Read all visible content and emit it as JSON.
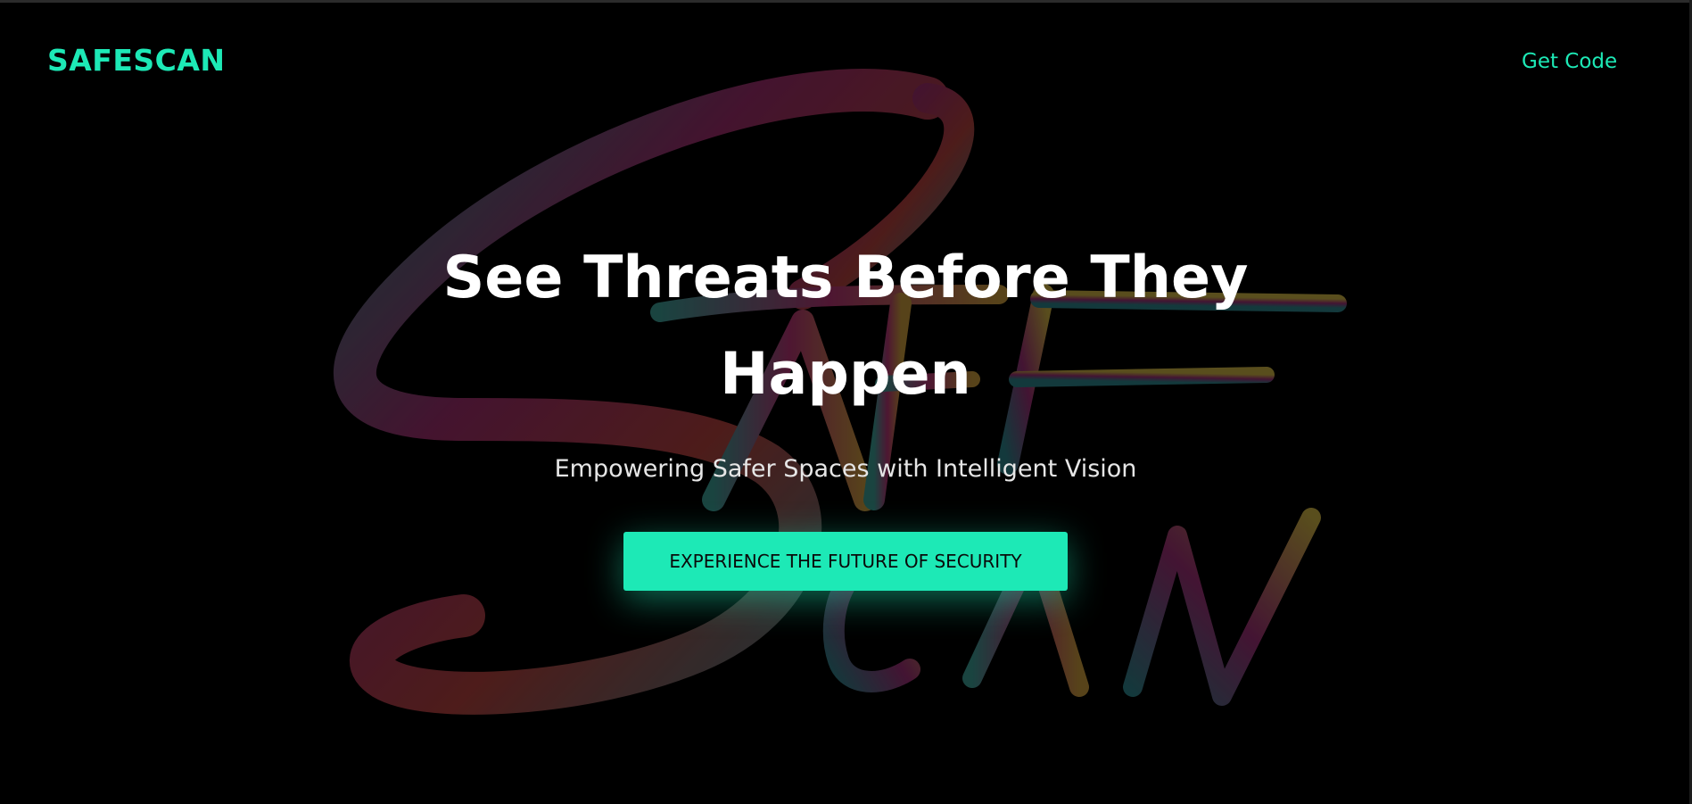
{
  "navbar": {
    "brand": "SAFESCAN",
    "get_code_link": "Get Code"
  },
  "hero": {
    "headline": "See Threats Before They Happen",
    "subtitle": "Empowering Safer Spaces with Intelligent Vision",
    "cta_label": "EXPERIENCE THE FUTURE OF SECURITY"
  },
  "colors": {
    "background": "#000000",
    "accent": "#1de9b6",
    "headline": "#ffffff",
    "subtitle": "#e6e6e6"
  },
  "icons": {
    "background_art": "safescan-brushstroke-lettering"
  }
}
